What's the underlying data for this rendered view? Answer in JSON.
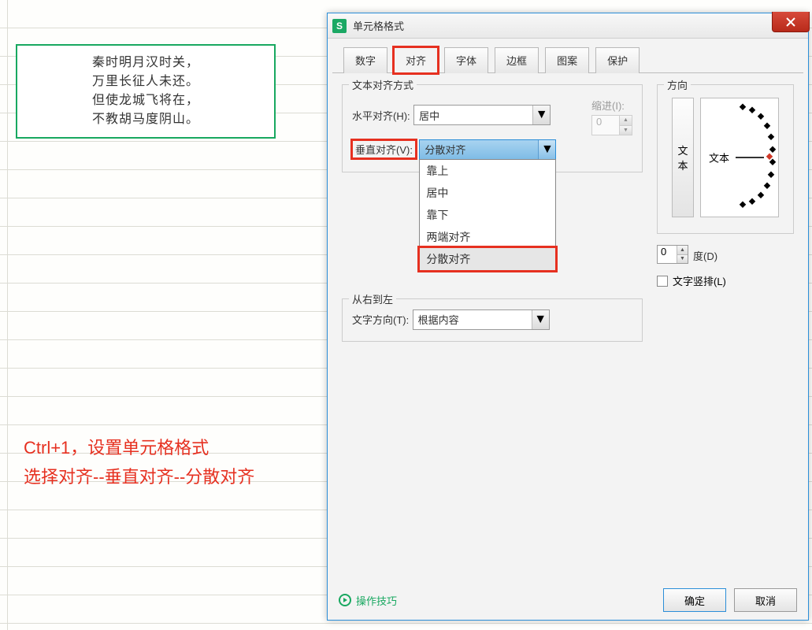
{
  "poem": [
    "秦时明月汉时关，",
    "万里长征人未还。",
    "但使龙城飞将在，",
    "不教胡马度阴山。"
  ],
  "instruction": [
    "Ctrl+1，设置单元格格式",
    "选择对齐--垂直对齐--分散对齐"
  ],
  "dialog": {
    "title": "单元格格式",
    "tabs": [
      "数字",
      "对齐",
      "字体",
      "边框",
      "图案",
      "保护"
    ],
    "group_align_legend": "文本对齐方式",
    "h_label": "水平对齐(H):",
    "h_value": "居中",
    "indent_label": "缩进(I):",
    "indent_value": "0",
    "v_label": "垂直对齐(V):",
    "v_value": "分散对齐",
    "v_options": [
      "靠上",
      "居中",
      "靠下",
      "两端对齐",
      "分散对齐"
    ],
    "group_rtl_legend": "从右到左",
    "text_dir_label": "文字方向(T):",
    "text_dir_value": "根据内容",
    "group_orient_legend": "方向",
    "vbtn_text": "文本",
    "dial_text": "文本",
    "deg_value": "0",
    "deg_label": "度(D)",
    "wrap_label": "文字竖排(L)",
    "tips": "操作技巧",
    "ok": "确定",
    "cancel": "取消"
  }
}
